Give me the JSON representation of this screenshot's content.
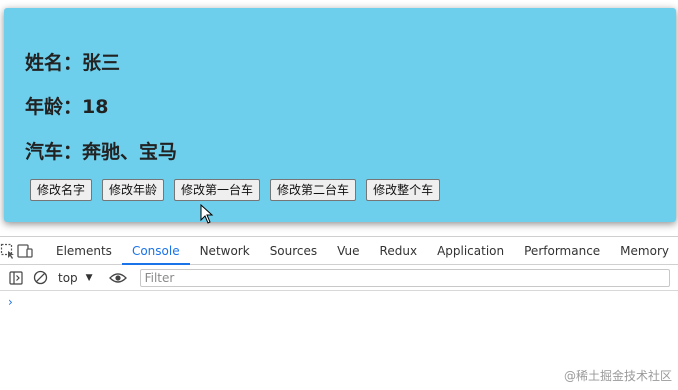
{
  "fields": {
    "name": "姓名：张三",
    "age": "年龄：18",
    "car": "汽车：奔驰、宝马"
  },
  "buttons": {
    "edit_name": "修改名字",
    "edit_age": "修改年龄",
    "edit_first_car": "修改第一台车",
    "edit_second_car": "修改第二台车",
    "edit_all_cars": "修改整个车"
  },
  "devtools": {
    "tabs": [
      "Elements",
      "Console",
      "Network",
      "Sources",
      "Vue",
      "Redux",
      "Application",
      "Performance",
      "Memory"
    ],
    "active_tab": "Console",
    "context": "top",
    "filter_placeholder": "Filter",
    "prompt": "›"
  },
  "watermark": "@稀土掘金技术社区",
  "colors": {
    "card_background": "#6ecfec",
    "accent": "#1a73e8"
  }
}
